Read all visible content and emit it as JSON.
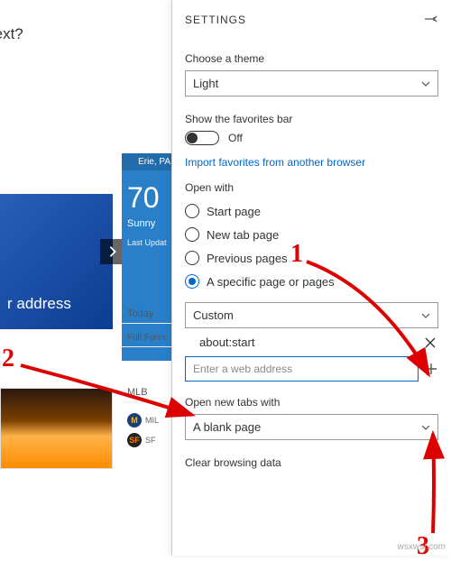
{
  "bg": {
    "prompt_suffix": "o next?",
    "blue_tile_text": "r address",
    "weather": {
      "location": "Erie, PA",
      "temp": "70",
      "condition": "Sunny",
      "last_update": "Last Updat"
    },
    "today": "Today",
    "forecast": "Full Forec",
    "mlb": "MLB",
    "teams": [
      {
        "abbr": "M",
        "code": "MIL"
      },
      {
        "abbr": "SF",
        "code": "SF"
      }
    ]
  },
  "settings": {
    "title": "SETTINGS",
    "theme_label": "Choose a theme",
    "theme_value": "Light",
    "fav_label": "Show the favorites bar",
    "fav_toggle": "Off",
    "import_link": "Import favorites from another browser",
    "openwith_label": "Open with",
    "openwith_options": {
      "start": "Start page",
      "newtab": "New tab page",
      "previous": "Previous pages",
      "specific": "A specific page or pages"
    },
    "custom_value": "Custom",
    "page_entry": "about:start",
    "address_placeholder": "Enter a web address",
    "newtabs_label": "Open new tabs with",
    "newtabs_value": "A blank page",
    "clear_label": "Clear browsing data"
  },
  "annotations": {
    "one": "1",
    "two": "2",
    "three": "3"
  },
  "watermark": "wsxwsj.com"
}
